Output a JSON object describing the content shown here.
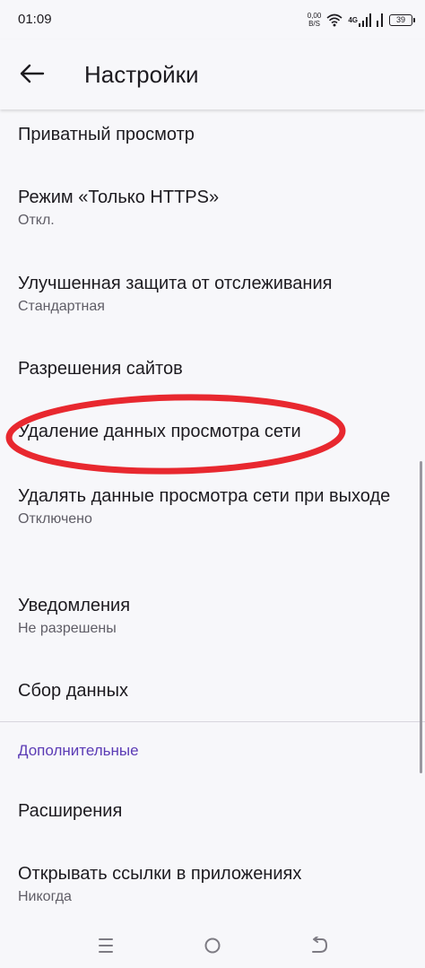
{
  "status_bar": {
    "time": "01:09",
    "net_speed_value": "0,00",
    "net_speed_unit": "B/S",
    "network_type": "4G",
    "battery_level": "39"
  },
  "header": {
    "title": "Настройки"
  },
  "settings": {
    "items": [
      {
        "title": "Приватный просмотр"
      },
      {
        "title": "Режим «Только HTTPS»",
        "subtitle": "Откл."
      },
      {
        "title": "Улучшенная защита от отслеживания",
        "subtitle": "Стандартная"
      },
      {
        "title": "Разрешения сайтов"
      },
      {
        "title": "Удаление данных просмотра сети"
      },
      {
        "title": "Удалять данные просмотра сети при выходе",
        "subtitle": "Отключено"
      },
      {
        "title": "Уведомления",
        "subtitle": "Не разрешены"
      },
      {
        "title": "Сбор данных"
      }
    ],
    "section_header": "Дополнительные",
    "advanced_items": [
      {
        "title": "Расширения"
      },
      {
        "title": "Открывать ссылки в приложениях",
        "subtitle": "Никогда"
      }
    ]
  },
  "colors": {
    "background": "#f7f7fa",
    "accent": "#5b3bb5",
    "highlight_annotation": "#e8282f"
  },
  "icons": {
    "back": "arrow-left-icon",
    "wifi": "wifi-icon",
    "signal": "cell-signal-icon",
    "battery": "battery-icon",
    "nav_menu": "recent-apps-icon",
    "nav_home": "home-circle-icon",
    "nav_back": "back-return-icon"
  }
}
